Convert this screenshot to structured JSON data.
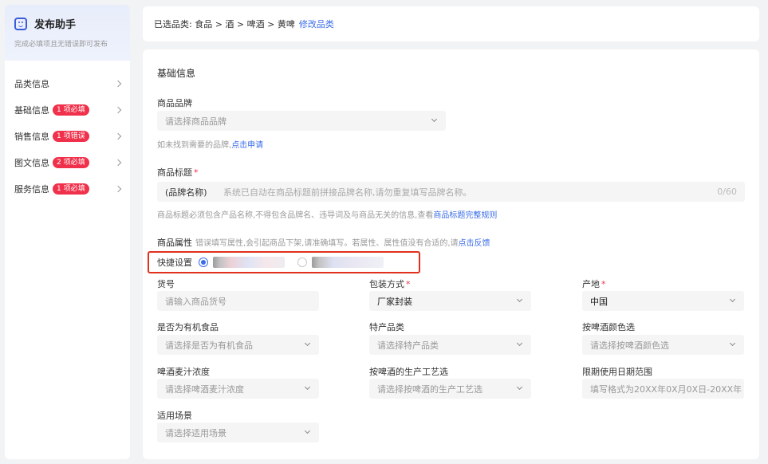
{
  "sidebar": {
    "title": "发布助手",
    "subtitle": "完成必填项且无错误即可发布",
    "items": [
      {
        "label": "品类信息",
        "badge": ""
      },
      {
        "label": "基础信息",
        "badge": "1 项必填"
      },
      {
        "label": "销售信息",
        "badge": "1 项错误"
      },
      {
        "label": "图文信息",
        "badge": "2 项必填"
      },
      {
        "label": "服务信息",
        "badge": "1 项必填"
      }
    ]
  },
  "breadcrumb": {
    "text": "已选品类:  食品 > 酒 > 啤酒 > 黄啤",
    "edit_link": "修改品类"
  },
  "form": {
    "section_title": "基础信息",
    "brand": {
      "label": "商品品牌",
      "placeholder": "请选择商品品牌",
      "hint": "如未找到需要的品牌,",
      "hint_link": "点击申请"
    },
    "title": {
      "label": "商品标题",
      "prefix": "(品牌名称)",
      "placeholder": "系统已自动在商品标题前拼接品牌名称,请勿重复填写品牌名称。",
      "count": "0/60",
      "hint": "商品标题必须包含产品名称,不得包含品牌名、违导词及与商品无关的信息,查看",
      "hint_link": "商品标题完整规则"
    },
    "attributes": {
      "label": "商品属性",
      "note": "错误填写属性,会引起商品下架,请准确填写。若属性、属性值没有合适的,请",
      "note_link": "点击反馈",
      "quick_label": "快捷设置"
    },
    "fields": [
      {
        "label": "货号",
        "required": false,
        "value": "请输入商品货号",
        "filled": false,
        "dropdown": false
      },
      {
        "label": "包装方式",
        "required": true,
        "value": "厂家封装",
        "filled": true,
        "dropdown": true
      },
      {
        "label": "产地",
        "required": true,
        "value": "中国",
        "filled": true,
        "dropdown": true
      },
      {
        "label": "是否为有机食品",
        "required": false,
        "value": "请选择是否为有机食品",
        "filled": false,
        "dropdown": true
      },
      {
        "label": "特产品类",
        "required": false,
        "value": "请选择特产品类",
        "filled": false,
        "dropdown": true
      },
      {
        "label": "按啤酒颜色选",
        "required": false,
        "value": "请选择按啤酒颜色选",
        "filled": false,
        "dropdown": true
      },
      {
        "label": "啤酒麦汁浓度",
        "required": false,
        "value": "请选择啤酒麦汁浓度",
        "filled": false,
        "dropdown": true
      },
      {
        "label": "按啤酒的生产工艺选",
        "required": false,
        "value": "请选择按啤酒的生产工艺选",
        "filled": false,
        "dropdown": true
      },
      {
        "label": "限期使用日期范围",
        "required": false,
        "value": "填写格式为20XX年0X月0X日-20XX年",
        "filled": false,
        "dropdown": false
      },
      {
        "label": "适用场景",
        "required": false,
        "value": "请选择适用场景",
        "filled": false,
        "dropdown": true
      }
    ]
  },
  "colors": {
    "accent": "#3b6de8",
    "badge": "#f0314b",
    "highlight_border": "#e0301e"
  }
}
